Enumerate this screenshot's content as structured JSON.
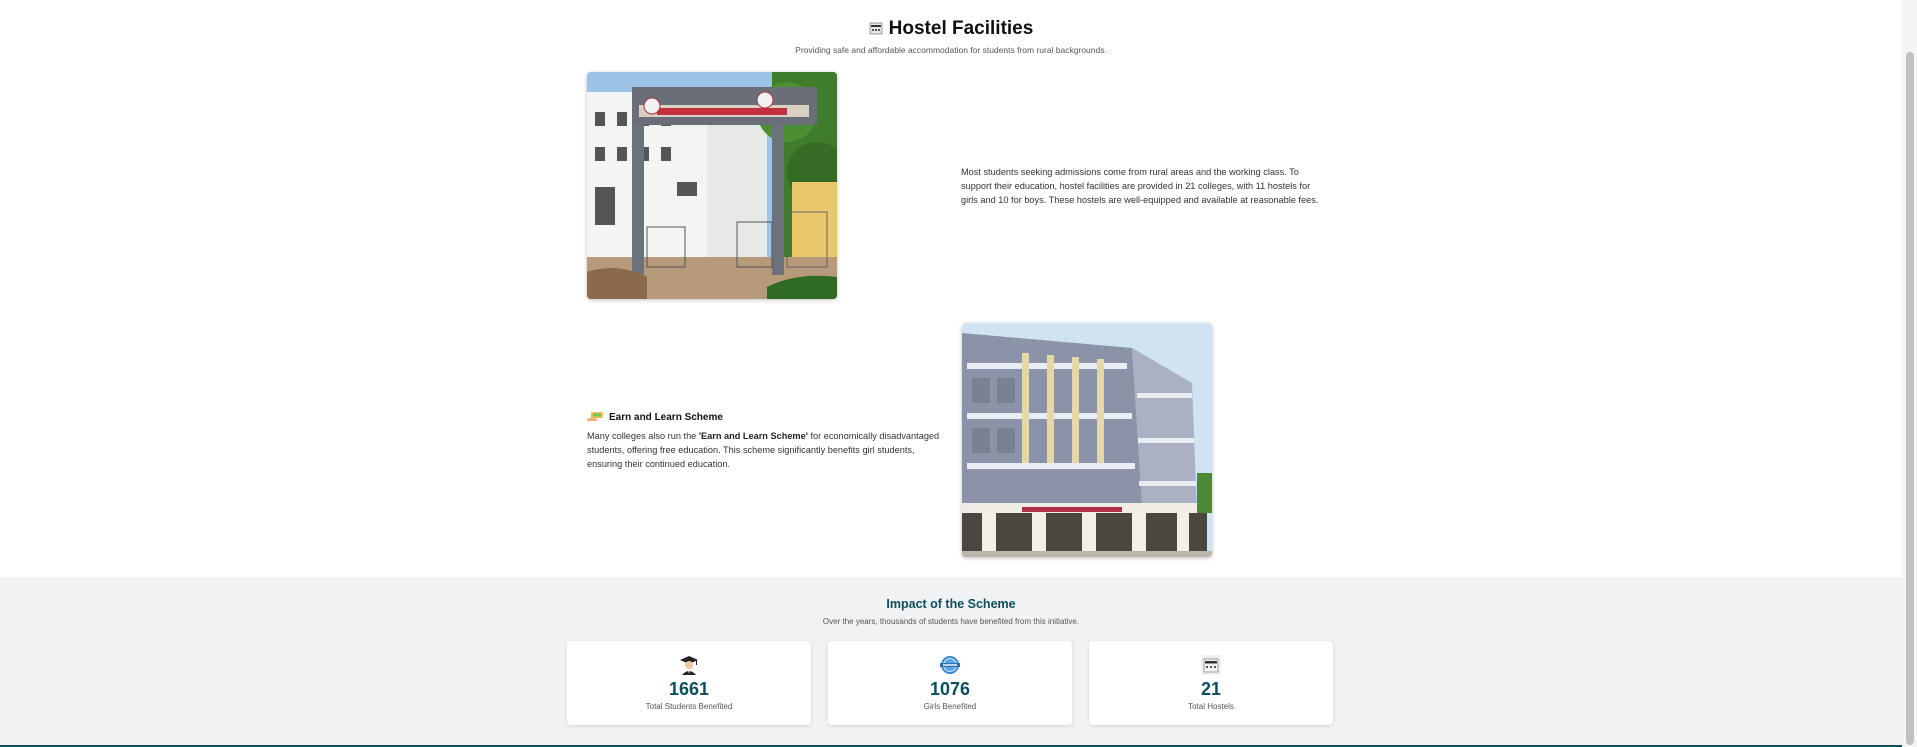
{
  "header": {
    "title": "Hostel Facilities",
    "subtitle": "Providing safe and affordable accommodation for students from rural backgrounds.",
    "title_icon": "hostel-building-icon"
  },
  "hostel_section": {
    "paragraph": "Most students seeking admissions come from rural areas and the working class. To support their education, hostel facilities are provided in 21 colleges, with 11 hostels for girls and 10 for boys. These hostels are well-equipped and available at reasonable fees.",
    "photo_1_icon": "hostel-gate-photo",
    "photo_2_icon": "hostel-building-photo"
  },
  "earn_learn": {
    "icon": "money-hand-icon",
    "heading": "Earn and Learn Scheme",
    "text_before": "Many colleges also run the ",
    "highlight": "'Earn and Learn Scheme'",
    "text_after": " for economically disadvantaged students, offering free education. This scheme significantly benefits girl students, ensuring their continued education."
  },
  "impact": {
    "title": "Impact of the Scheme",
    "subtitle": "Over the years, thousands of students have benefited from this initiative.",
    "stats": [
      {
        "icon": "graduate-icon",
        "value": "1661",
        "label": "Total Students Benefited"
      },
      {
        "icon": "badge-icon",
        "value": "1076",
        "label": "Girls Benefited"
      },
      {
        "icon": "hostel-building-icon",
        "value": "21",
        "label": "Total Hostels"
      }
    ]
  },
  "colors": {
    "accent": "#0d4f5c",
    "section_bg": "#f0f2f4"
  }
}
